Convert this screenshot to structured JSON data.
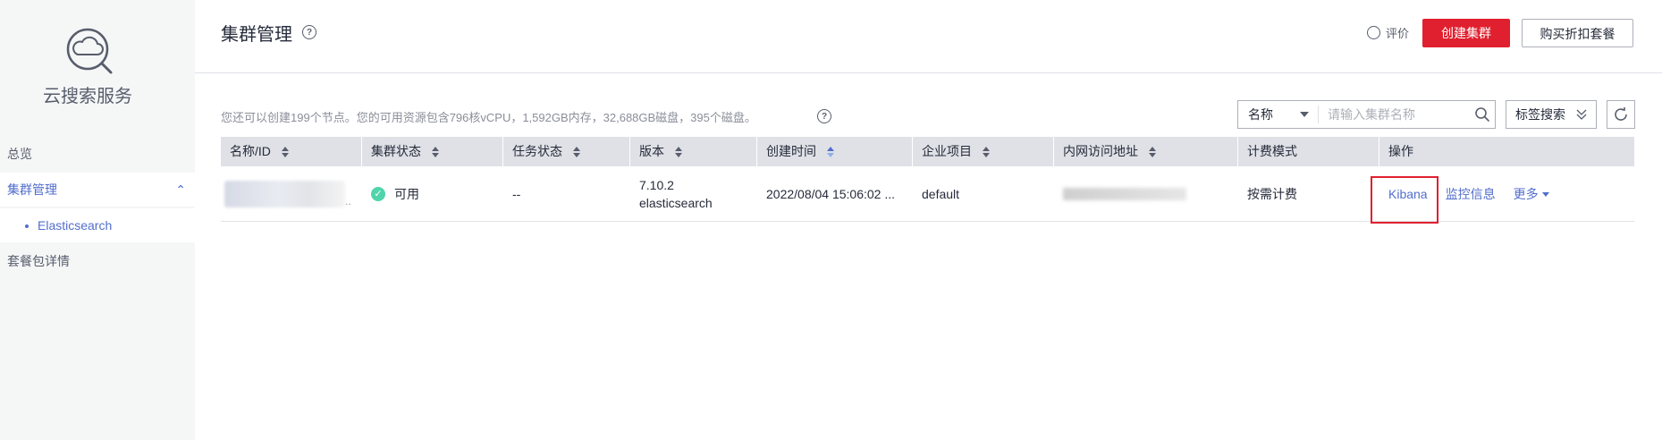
{
  "sidebar": {
    "service_name": "云搜索服务",
    "items": [
      {
        "label": "总览"
      },
      {
        "label": "集群管理"
      },
      {
        "label": "Elasticsearch"
      },
      {
        "label": "套餐包详情"
      }
    ]
  },
  "header": {
    "title": "集群管理",
    "feedback_label": "评价",
    "create_button": "创建集群",
    "buy_button": "购买折扣套餐"
  },
  "toolbar": {
    "quota_text": "您还可以创建199个节点。您的可用资源包含796核vCPU，1,592GB内存，32,688GB磁盘，395个磁盘。",
    "search_field": "名称",
    "search_placeholder": "请输入集群名称",
    "tag_search_label": "标签搜索"
  },
  "table": {
    "columns": [
      "名称/ID",
      "集群状态",
      "任务状态",
      "版本",
      "创建时间",
      "企业项目",
      "内网访问地址",
      "计费模式",
      "操作"
    ],
    "rows": [
      {
        "name_suffix": "..",
        "status": "可用",
        "task_status": "--",
        "version_number": "7.10.2",
        "version_type": "elasticsearch",
        "created": "2022/08/04 15:06:02 ...",
        "enterprise_project": "default",
        "billing": "按需计费",
        "actions": {
          "kibana": "Kibana",
          "monitor": "监控信息",
          "more": "更多"
        }
      }
    ]
  },
  "colors": {
    "primary": "#e0202f",
    "link": "#526ecc",
    "success": "#50d4ab",
    "highlight_box": "#e0202f"
  }
}
